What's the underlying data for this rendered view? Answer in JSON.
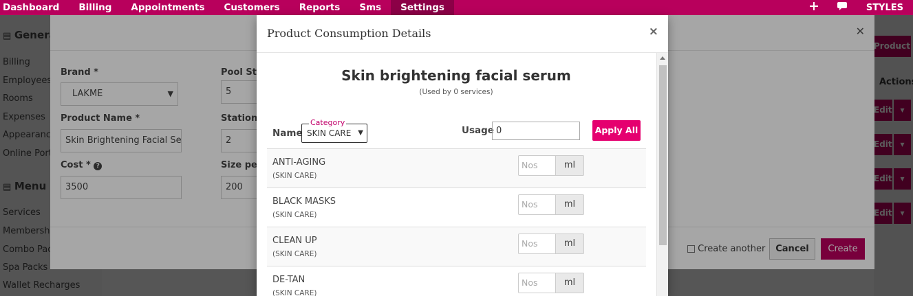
{
  "nav": {
    "items": [
      "Dashboard",
      "Billing",
      "Appointments",
      "Customers",
      "Reports",
      "Sms",
      "Settings"
    ],
    "active": "Settings",
    "plus_icon": "plus-icon",
    "chat_icon": "chat-icon",
    "styles_label": "STYLES"
  },
  "sidebar": {
    "general_heading": "General",
    "general_items": [
      "Billing",
      "Employees",
      "Rooms",
      "Expenses",
      "Appearance",
      "Online Port"
    ],
    "menu_heading": "Menu",
    "menu_items": [
      "Services",
      "Membership",
      "Combo Pac",
      "Spa Packs",
      "Wallet Recharges"
    ]
  },
  "background": {
    "add_product_label": "Product",
    "actions_header": "Actions",
    "edit_label": "Edit"
  },
  "product_form": {
    "brand_label": "Brand *",
    "brand_value": "LAKME",
    "pool_stock_label": "Pool Sto",
    "pool_stock_value": "5",
    "product_name_label": "Product Name *",
    "product_name_value": "Skin Brightening Facial Seru",
    "station_label": "Station S",
    "station_value": "2",
    "cost_label": "Cost *",
    "cost_value": "3500",
    "size_label": "Size per",
    "size_value": "200",
    "create_another_label": "Create another",
    "cancel_label": "Cancel",
    "create_label": "Create"
  },
  "modal": {
    "title": "Product Consumption Details",
    "close_icon": "×",
    "product_title": "Skin brightening facial serum",
    "product_subtitle": "(Used by 0 services)",
    "name_label": "Name",
    "category_legend": "Category",
    "category_value": "SKIN CARE",
    "usage_label": "Usage",
    "usage_value": "0",
    "apply_all_label": "Apply All",
    "nos_placeholder": "Nos",
    "unit_label": "ml",
    "rows": [
      {
        "name": "ANTI-AGING",
        "category": "(SKIN CARE)"
      },
      {
        "name": "BLACK MASKS",
        "category": "(SKIN CARE)"
      },
      {
        "name": "CLEAN UP",
        "category": "(SKIN CARE)"
      },
      {
        "name": "DE-TAN",
        "category": "(SKIN CARE)"
      }
    ]
  },
  "colors": {
    "brand": "#b8005c",
    "accent": "#e5006f",
    "nav_active": "#8c0047"
  }
}
